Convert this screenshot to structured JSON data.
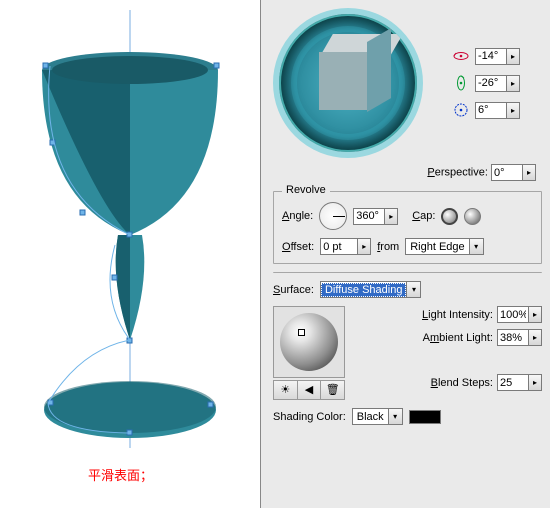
{
  "caption": "平滑表面；",
  "rotation": {
    "x": "-14°",
    "y": "-26°",
    "z": "6°"
  },
  "perspective": {
    "label": "Perspective:",
    "label_und": "P",
    "value": "0°"
  },
  "revolve": {
    "legend": "Revolve",
    "angle_label": "Angle:",
    "angle_und": "A",
    "angle": "360°",
    "cap_label": "Cap:",
    "cap_und": "C",
    "offset_label": "Offset:",
    "offset_und": "O",
    "offset": "0 pt",
    "from_label": "from",
    "from_und": "f",
    "from_value": "Right Edge"
  },
  "surface": {
    "label": "Surface:",
    "label_und": "S",
    "value": "Diffuse Shading",
    "light_intensity_label": "Light Intensity:",
    "light_intensity_und": "L",
    "light_intensity": "100%",
    "ambient_label": "Ambient Light:",
    "ambient_und": "m",
    "ambient": "38%",
    "blend_label": "Blend Steps:",
    "blend_und": "B",
    "blend": "25",
    "shading_color_label": "Shading Color:",
    "shading_color": "Black"
  },
  "buttons": {
    "new": "☀",
    "back": "◀",
    "trash": "🗑"
  },
  "chart_data": null
}
